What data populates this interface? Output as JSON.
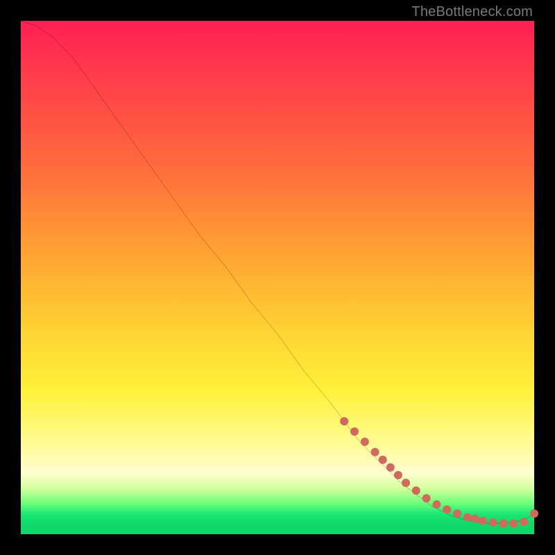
{
  "watermark": "TheBottleneck.com",
  "chart_data": {
    "type": "line",
    "title": "",
    "xlabel": "",
    "ylabel": "",
    "xlim": [
      0,
      100
    ],
    "ylim": [
      0,
      100
    ],
    "grid": false,
    "line": {
      "x": [
        0,
        3,
        6,
        10,
        15,
        20,
        25,
        30,
        35,
        40,
        45,
        50,
        55,
        60,
        63,
        66,
        69,
        72,
        74,
        76,
        78,
        80,
        82,
        84,
        86,
        87,
        88,
        90,
        92,
        94,
        96,
        98,
        100
      ],
      "y": [
        100,
        99,
        97,
        93,
        86,
        79,
        72,
        65,
        58,
        52,
        45,
        39,
        32,
        26,
        22,
        18,
        15,
        12,
        10,
        8.5,
        7,
        5.5,
        4.5,
        3.5,
        3,
        2.7,
        2.5,
        2.2,
        2.1,
        2.1,
        2.3,
        2.8,
        4
      ]
    },
    "markers": {
      "x": [
        63,
        65,
        67,
        69,
        70.5,
        72,
        73.5,
        75,
        77,
        79,
        81,
        83,
        85,
        87,
        88.5,
        90,
        92,
        94,
        96,
        98,
        100
      ],
      "y": [
        22,
        20,
        18,
        16,
        14.5,
        13,
        11.5,
        10,
        8.5,
        7,
        5.8,
        4.8,
        4,
        3.3,
        3,
        2.6,
        2.3,
        2.1,
        2.1,
        2.4,
        4
      ],
      "color": "#cf6a5d",
      "radius_px": 6
    },
    "background_gradient": {
      "direction": "top-to-bottom",
      "stops": [
        {
          "pos": 0.0,
          "color": "#ff1f55"
        },
        {
          "pos": 0.28,
          "color": "#ff6a3d"
        },
        {
          "pos": 0.6,
          "color": "#ffd233"
        },
        {
          "pos": 0.82,
          "color": "#fffb90"
        },
        {
          "pos": 0.94,
          "color": "#6dff7a"
        },
        {
          "pos": 1.0,
          "color": "#0fd86a"
        }
      ]
    }
  }
}
